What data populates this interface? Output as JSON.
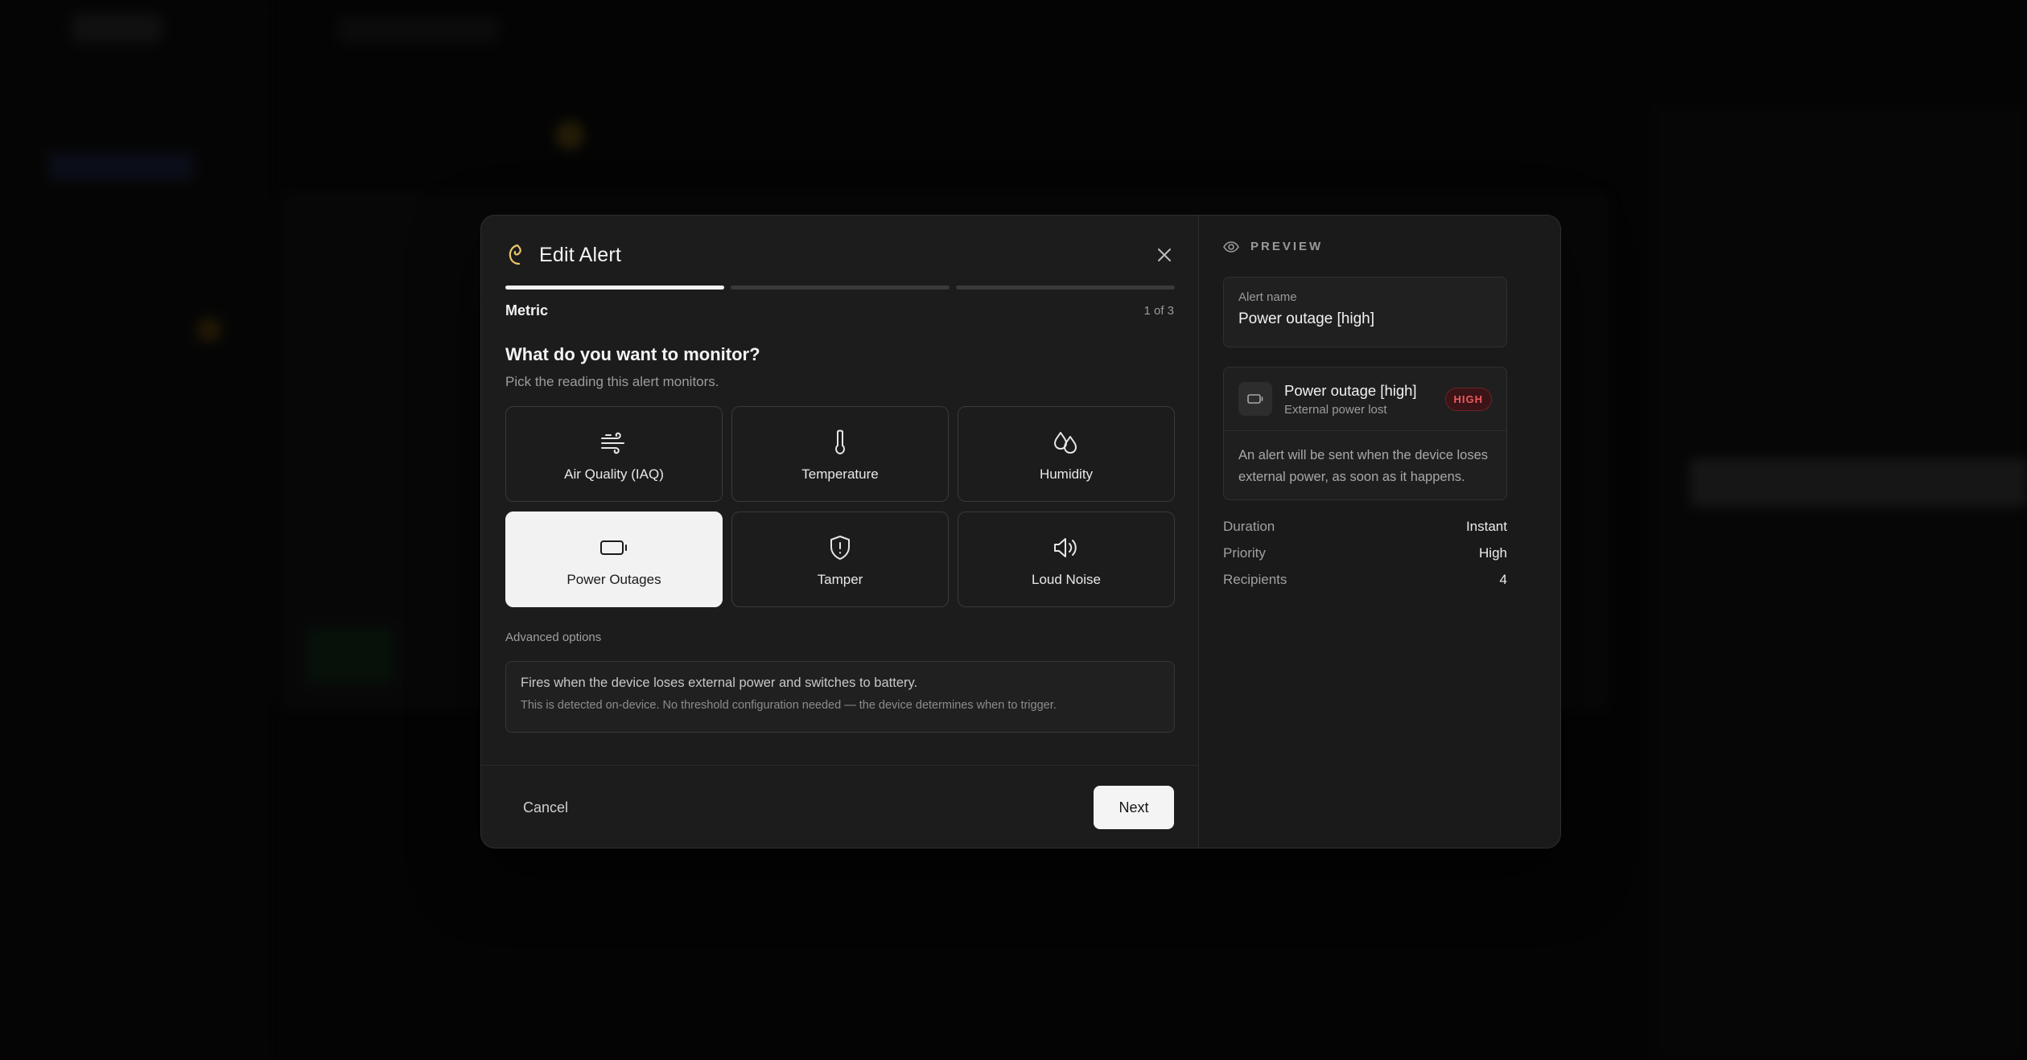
{
  "modal": {
    "title": "Edit Alert",
    "close_icon": "close-icon",
    "progress": {
      "current_step": 1,
      "total_steps": 3
    },
    "step_label": "Metric",
    "step_count": "1 of 3",
    "question": "What do you want to monitor?",
    "subtitle": "Pick the reading this alert monitors.",
    "metrics": [
      {
        "label": "Air Quality (IAQ)",
        "icon": "wind-icon",
        "selected": false
      },
      {
        "label": "Temperature",
        "icon": "thermometer-icon",
        "selected": false
      },
      {
        "label": "Humidity",
        "icon": "droplets-icon",
        "selected": false
      },
      {
        "label": "Power Outages",
        "icon": "battery-icon",
        "selected": true
      },
      {
        "label": "Tamper",
        "icon": "shield-alert-icon",
        "selected": false
      },
      {
        "label": "Loud Noise",
        "icon": "volume-icon",
        "selected": false
      }
    ],
    "advanced_label": "Advanced options",
    "info_primary": "Fires when the device loses external power and switches to battery.",
    "info_secondary": "This is detected on-device. No threshold configuration needed — the device determines when to trigger.",
    "cancel_label": "Cancel",
    "next_label": "Next"
  },
  "preview": {
    "heading": "PREVIEW",
    "alert_name_label": "Alert name",
    "alert_name_value": "Power outage [high]",
    "card_title": "Power outage [high]",
    "card_subtitle": "External power lost",
    "badge": "HIGH",
    "description": "An alert will be sent when the device loses external power, as soon as it happens.",
    "summary": [
      {
        "key": "Duration",
        "value": "Instant"
      },
      {
        "key": "Priority",
        "value": "High"
      },
      {
        "key": "Recipients",
        "value": "4"
      }
    ]
  },
  "colors": {
    "accent": "#f2f2f2",
    "logo": "#e9c46a",
    "badge_text": "#ef5a5e",
    "badge_bg": "#3a1416"
  }
}
